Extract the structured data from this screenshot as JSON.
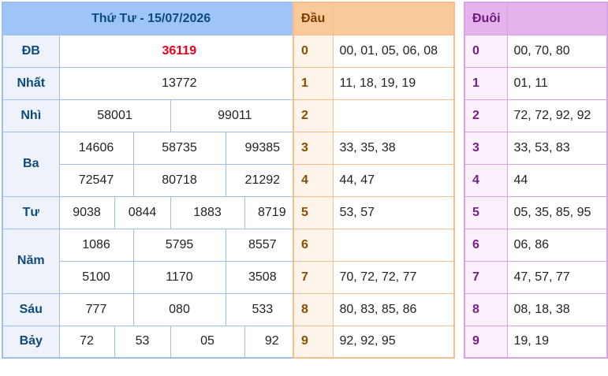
{
  "title": "Thứ Tư - 15/07/2026",
  "prizes": {
    "db": {
      "label": "ĐB",
      "values": [
        "36119"
      ]
    },
    "nhat": {
      "label": "Nhất",
      "values": [
        "13772"
      ]
    },
    "nhi": {
      "label": "Nhì",
      "values": [
        "58001",
        "99011"
      ]
    },
    "ba": {
      "label": "Ba",
      "values": [
        "14606",
        "58735",
        "99385",
        "72547",
        "80718",
        "21292"
      ]
    },
    "tu": {
      "label": "Tư",
      "values": [
        "9038",
        "0844",
        "1883",
        "8719"
      ]
    },
    "nam": {
      "label": "Năm",
      "values": [
        "1086",
        "5795",
        "8557",
        "5100",
        "1170",
        "3508"
      ]
    },
    "sau": {
      "label": "Sáu",
      "values": [
        "777",
        "080",
        "533"
      ]
    },
    "bay": {
      "label": "Bảy",
      "values": [
        "72",
        "53",
        "05",
        "92"
      ]
    }
  },
  "dau": {
    "header": "Đầu",
    "rows": [
      {
        "k": "0",
        "v": "00, 01, 05, 06, 08"
      },
      {
        "k": "1",
        "v": "11, 18, 19, 19"
      },
      {
        "k": "2",
        "v": ""
      },
      {
        "k": "3",
        "v": "33, 35, 38"
      },
      {
        "k": "4",
        "v": "44, 47"
      },
      {
        "k": "5",
        "v": "53, 57"
      },
      {
        "k": "6",
        "v": ""
      },
      {
        "k": "7",
        "v": "70, 72, 72, 77"
      },
      {
        "k": "8",
        "v": "80, 83, 85, 86"
      },
      {
        "k": "9",
        "v": "92, 92, 95"
      }
    ]
  },
  "duoi": {
    "header": "Đuôi",
    "rows": [
      {
        "k": "0",
        "v": "00, 70, 80"
      },
      {
        "k": "1",
        "v": "01, 11"
      },
      {
        "k": "2",
        "v": "72, 72, 92, 92"
      },
      {
        "k": "3",
        "v": "33, 53, 83"
      },
      {
        "k": "4",
        "v": "44"
      },
      {
        "k": "5",
        "v": "05, 35, 85, 95"
      },
      {
        "k": "6",
        "v": "06, 86"
      },
      {
        "k": "7",
        "v": "47, 57, 77"
      },
      {
        "k": "8",
        "v": "08, 18, 38"
      },
      {
        "k": "9",
        "v": "19, 19"
      }
    ]
  },
  "colors": {
    "special_prize": "#e8001b",
    "results_header": "#9fc5f8",
    "dau_header": "#f9c99a",
    "duoi_header": "#e5b3ec"
  }
}
